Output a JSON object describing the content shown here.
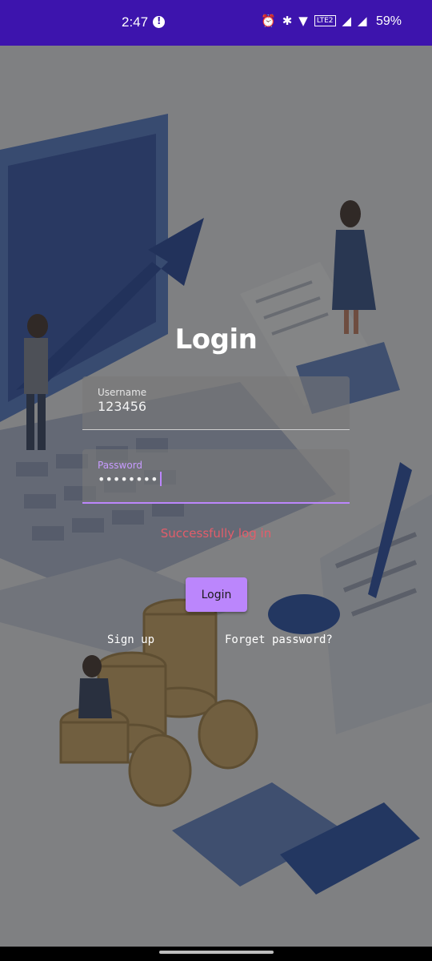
{
  "status_bar": {
    "time": "2:47",
    "battery": "59%",
    "lte_label": "LTE2",
    "icons": [
      "alarm-icon",
      "bluetooth-icon",
      "wifi-icon",
      "volte-icon",
      "signal-icon",
      "signal-icon"
    ]
  },
  "login": {
    "title": "Login",
    "username": {
      "label": "Username",
      "value": "123456"
    },
    "password": {
      "label": "Password",
      "value": "••••••••"
    },
    "message": "Successfully log in",
    "login_button": "Login",
    "signup_link": "Sign up",
    "forget_link": "Forget password?"
  },
  "colors": {
    "status_bar": "#3d14ad",
    "accent": "#bb86fc",
    "message": "#e35d6a"
  }
}
